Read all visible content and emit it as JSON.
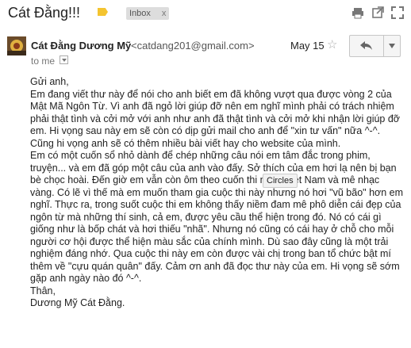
{
  "email": {
    "subject": "Cát Đằng!!!",
    "label": "Inbox",
    "label_remove": "x",
    "colors": {
      "label_tag": "#f4c430",
      "chip": "#dddddd"
    }
  },
  "header_actions": {
    "print_icon": "print-icon",
    "newwin_icon": "new-window-icon",
    "fullscreen_icon": "fullscreen-icon"
  },
  "sender": {
    "name": "Cát Đằng Dương Mỹ",
    "email": "<catdang201@gmail.com>",
    "date": "May 15",
    "to": "to me"
  },
  "tooltip": "Circles",
  "body": [
    "Gửi anh,",
    "Em đang viết thư này để nói cho anh biết em đã không vượt qua được vòng 2 của Mật Mã Ngôn Từ. Vì anh đã ngỏ lời giúp đỡ nên em nghĩ mình phải có trách nhiệm phải thật tình và cởi mở với anh như anh đã thật tình và cởi mở khi nhận lời giúp đỡ em. Hi vọng sau này em sẽ còn có dịp gửi mail cho anh để \"xin tư vấn\" nữa ^-^. Cũng hi vọng anh sẽ có thêm nhiều bài viết hay cho website của mình.",
    "Em có một cuốn sổ nhỏ dành để chép những câu nói em tâm đắc trong phim, truyện... và em đã góp một câu của anh vào đấy. Sở thích của em hơi lạ nên bị bạn bè chọc hoài. Đến giờ em vẫn còn ôm theo cuốn thi nhân Việt Nam và mê nhạc vàng. Có lẽ vì thế mà em muốn tham gia cuộc thi này nhưng nó hơi \"vũ bão\" hơn em nghĩ. Thực ra, trong suốt cuộc thi em không thấy niềm đam mê phô diễn cái đẹp của ngôn từ mà những thí sinh, cả em, được yêu cầu thể hiện trong đó. Nó có cái gì giống như là bốp chát và hơi thiếu \"nhã\". Nhưng nó cũng có cái hay ở chỗ cho mỗi người cơ hội được thể hiện màu sắc của chính mình. Dù sao đây cũng là một trải nghiệm đáng nhớ. Qua cuộc thi này em còn được vài chị trong ban tổ chức bật mí thêm về \"cựu quán quân\" đấy. Cảm ơn anh đã đọc thư này của em. Hi vọng sẽ sớm gặp anh ngày nào đó ^-^.",
    "Thân,",
    "Dương Mỹ Cát Đằng."
  ]
}
